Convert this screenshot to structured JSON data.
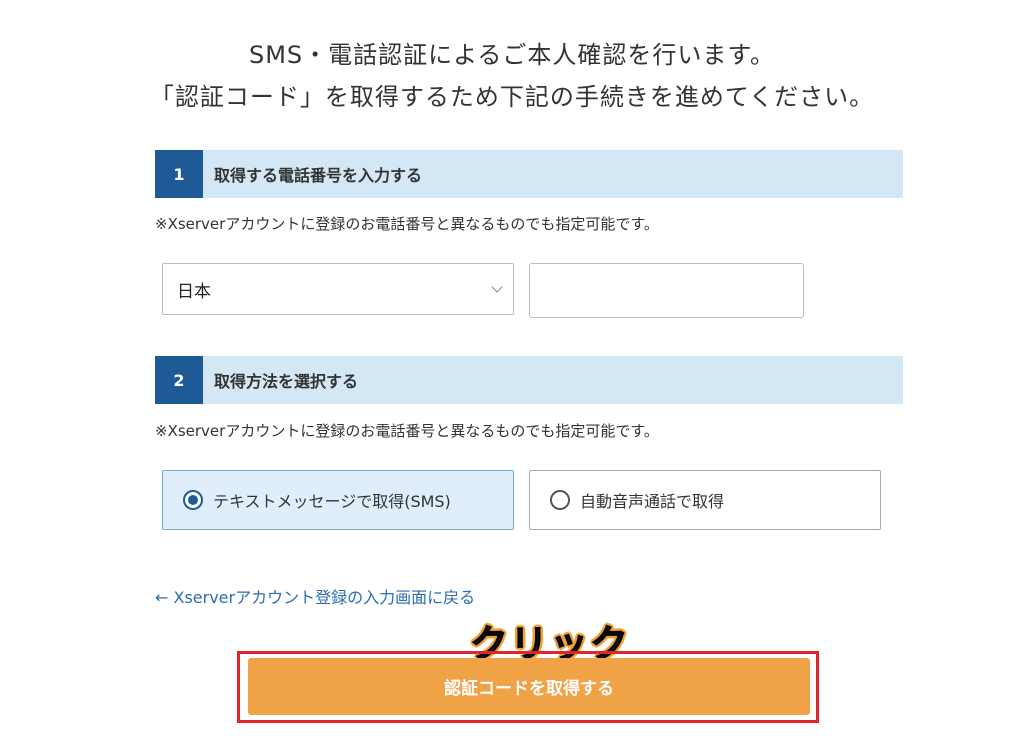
{
  "intro": {
    "line1": "SMS・電話認証によるご本人確認を行います。",
    "line2": "「認証コード」を取得するため下記の手続きを進めてください。"
  },
  "step1": {
    "number": "1",
    "title": "取得する電話番号を入力する",
    "note": "※Xserverアカウントに登録のお電話番号と異なるものでも指定可能です。",
    "country_select": {
      "value": "日本"
    },
    "phone_input": {
      "value": "",
      "placeholder": ""
    }
  },
  "step2": {
    "number": "2",
    "title": "取得方法を選択する",
    "note": "※Xserverアカウントに登録のお電話番号と異なるものでも指定可能です。",
    "options": [
      {
        "label": "テキストメッセージで取得(SMS)",
        "selected": true
      },
      {
        "label": "自動音声通話で取得",
        "selected": false
      }
    ]
  },
  "back_link": "← Xserverアカウント登録の入力画面に戻る",
  "annotation": "クリック",
  "submit_button": "認証コードを取得する",
  "colors": {
    "step_badge": "#1e5a96",
    "step_header_bg": "#d4e7f5",
    "submit_bg": "#f0a247",
    "link": "#2a6db0",
    "highlight_border": "#e0262b"
  },
  "icons": {
    "select_chevron": "chevron-down-icon",
    "radio_checked": "radio-checked-icon",
    "radio_unchecked": "radio-unchecked-icon"
  }
}
